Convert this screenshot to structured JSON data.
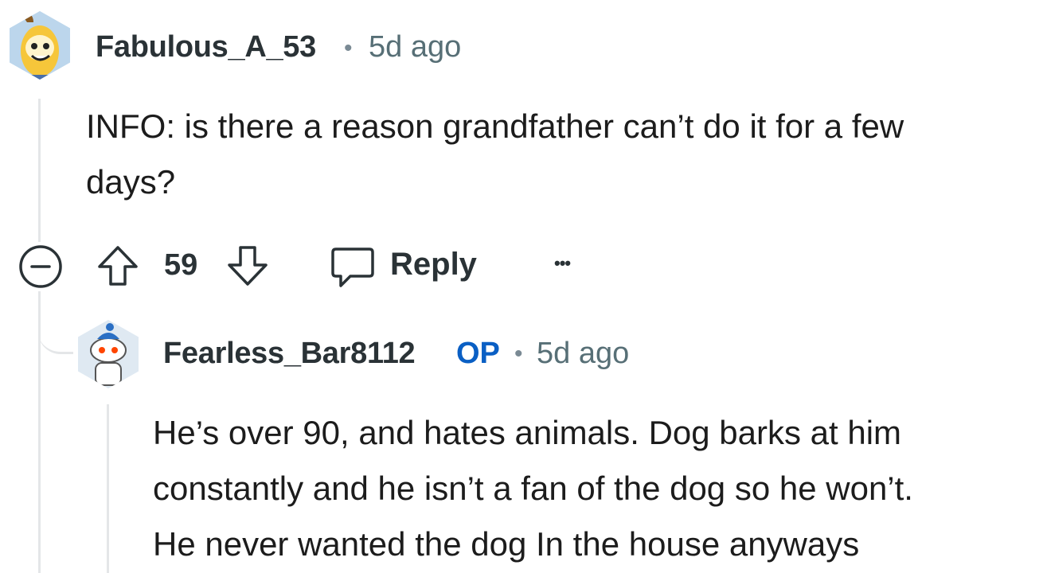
{
  "comment": {
    "username": "Fabulous_A_53",
    "separator": "•",
    "time": "5d ago",
    "body_line1": "INFO: is there a reason grandfather can’t do it for a few",
    "body_line2": "days?",
    "vote_count": "59",
    "reply_label": "Reply",
    "more_label": "•••"
  },
  "reply": {
    "username": "Fearless_Bar8112",
    "op_badge": "OP",
    "separator": "•",
    "time": "5d ago",
    "body_line1": "He’s over 90, and hates animals. Dog barks at him",
    "body_line2": "constantly and he isn’t a fan of the dog so he won’t.",
    "body_line3": "He never wanted the dog In the house anyways"
  },
  "colors": {
    "op_accent": "#0a5fc4",
    "thread_line": "#e4e6e8",
    "meta_gray": "#576f76"
  },
  "icons": [
    "banana-avatar-icon",
    "collapse-icon",
    "upvote-icon",
    "downvote-icon",
    "comment-bubble-icon",
    "more-options-icon",
    "snoo-avatar-icon"
  ]
}
